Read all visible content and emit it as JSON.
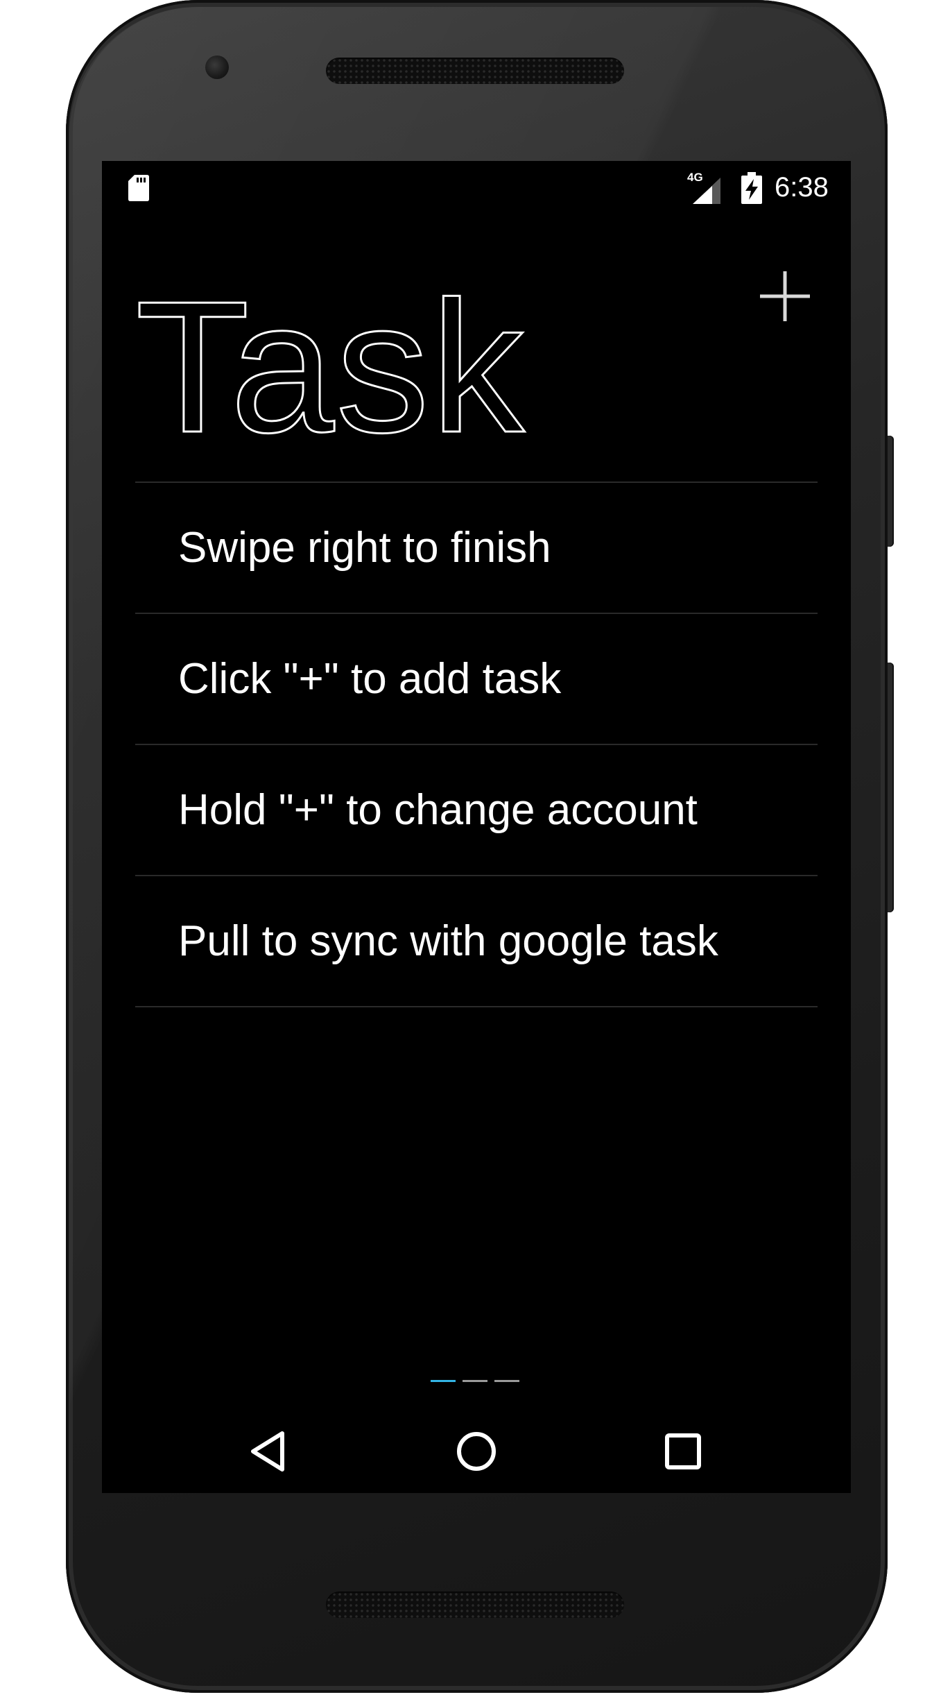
{
  "status_bar": {
    "network": "4G",
    "time": "6:38",
    "icons": [
      "sd-card-icon",
      "cell-signal-icon",
      "battery-charging-icon"
    ]
  },
  "header": {
    "title": "Task",
    "add_icon": "plus-icon"
  },
  "tasks": [
    {
      "label": "Swipe right to finish"
    },
    {
      "label": "Click \"+\" to add task"
    },
    {
      "label": "Hold \"+\" to change account"
    },
    {
      "label": "Pull to sync with google task"
    }
  ],
  "page_indicator": {
    "pages": 3,
    "active_index": 0,
    "active_color": "#33b5e5",
    "inactive_color": "#9a9a9a"
  },
  "nav_bar": {
    "icons": [
      "back-icon",
      "home-icon",
      "recents-icon"
    ]
  },
  "colors": {
    "screen_background": "#000000",
    "text": "#ffffff",
    "divider": "#2a2a2a",
    "device_body": "#262626"
  }
}
